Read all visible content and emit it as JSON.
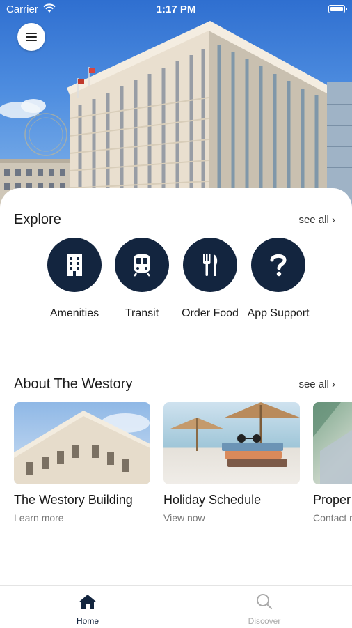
{
  "status_bar": {
    "carrier": "Carrier",
    "time": "1:17 PM"
  },
  "explore": {
    "title": "Explore",
    "see_all": "see all ›",
    "items": [
      {
        "label": "Amenities",
        "icon": "building-icon"
      },
      {
        "label": "Transit",
        "icon": "train-icon"
      },
      {
        "label": "Order Food",
        "icon": "fork-knife-icon"
      },
      {
        "label": "App Support",
        "icon": "question-icon"
      }
    ]
  },
  "about": {
    "title": "About The Westory",
    "see_all": "see all ›",
    "cards": [
      {
        "title": "The Westory Building",
        "subtitle": "Learn more"
      },
      {
        "title": "Holiday Schedule",
        "subtitle": "View now"
      },
      {
        "title": "Proper",
        "subtitle": "Contact m"
      }
    ]
  },
  "tabs": [
    {
      "label": "Home",
      "active": true
    },
    {
      "label": "Discover",
      "active": false
    }
  ],
  "colors": {
    "accent": "#13253f",
    "inactive_tab": "#aaaaaa"
  }
}
